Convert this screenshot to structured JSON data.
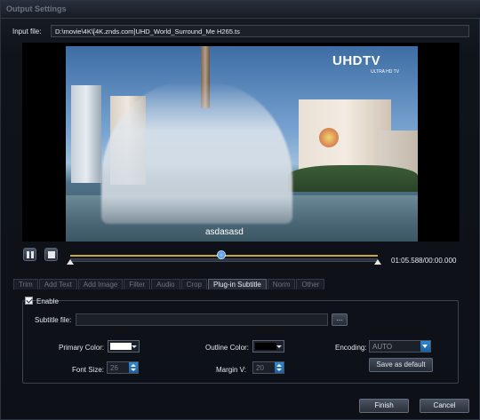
{
  "window": {
    "title": "Output Settings"
  },
  "input_file": {
    "label": "Input file:",
    "value": "D:\\movie\\4K\\[4K.znds.com]UHD_World_Surround_Me H265.ts"
  },
  "preview": {
    "watermark": "UHDTV",
    "watermark_sub": "ULTRA HD TV",
    "subtitle_text": "asdasasd"
  },
  "playback": {
    "timecode": "01:05.588/00:00.000",
    "progress_fraction": 0.49
  },
  "tabs": [
    {
      "label": "Trim",
      "active": false
    },
    {
      "label": "Add Text",
      "active": false
    },
    {
      "label": "Add Image",
      "active": false
    },
    {
      "label": "Filter",
      "active": false
    },
    {
      "label": "Audio",
      "active": false
    },
    {
      "label": "Crop",
      "active": false
    },
    {
      "label": "Plug-in Subtitle",
      "active": true
    },
    {
      "label": "Norm",
      "active": false
    },
    {
      "label": "Other",
      "active": false
    }
  ],
  "subtitle_panel": {
    "enable_label": "Enable",
    "enabled": true,
    "subtitle_file_label": "Subtitle file:",
    "subtitle_file_value": "",
    "browse_label": "...",
    "primary_color_label": "Primary Color:",
    "primary_color": "#ffffff",
    "outline_color_label": "Outline Color:",
    "outline_color": "#000000",
    "encoding_label": "Encoding:",
    "encoding_value": "AUTO",
    "font_size_label": "Font Size:",
    "font_size_value": "26",
    "margin_v_label": "Margin V:",
    "margin_v_value": "20",
    "save_default_label": "Save as default"
  },
  "footer": {
    "finish_label": "Finish",
    "cancel_label": "Cancel"
  }
}
